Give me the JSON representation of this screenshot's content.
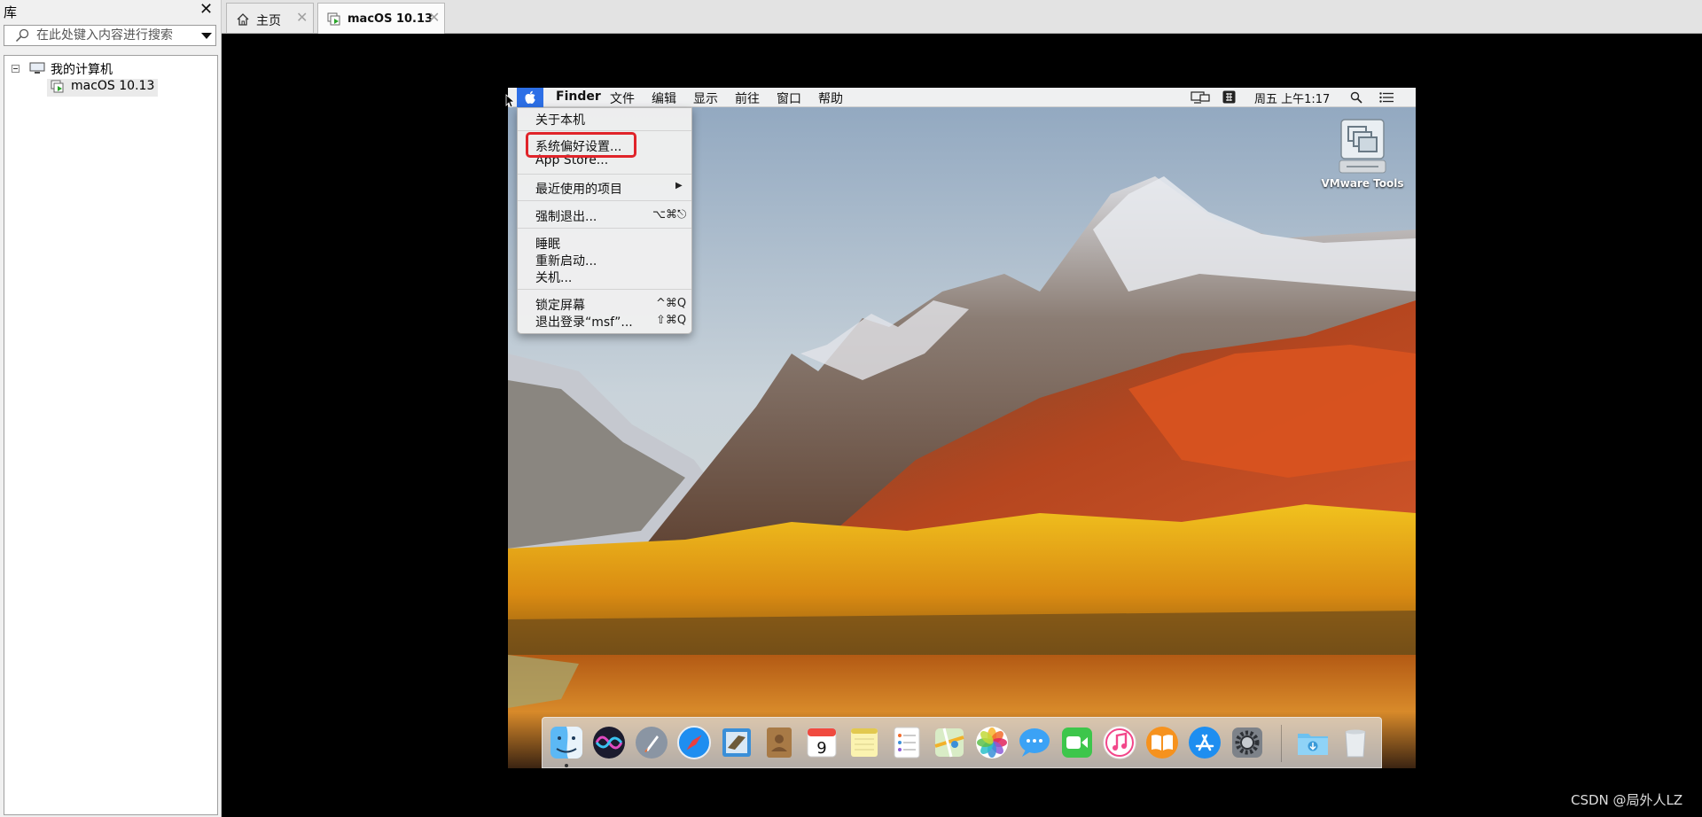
{
  "library": {
    "title": "库",
    "search_placeholder": "在此处键入内容进行搜索",
    "tree": {
      "root_label": "我的计算机",
      "vm_label": "macOS 10.13"
    }
  },
  "tabs": [
    {
      "label": "主页",
      "icon": "home-icon",
      "active": false
    },
    {
      "label": "macOS 10.13",
      "icon": "vm-icon",
      "active": true
    }
  ],
  "mac": {
    "menubar": {
      "app": "Finder",
      "items": [
        "文件",
        "编辑",
        "显示",
        "前往",
        "窗口",
        "帮助"
      ],
      "clock": "周五 上午1:17"
    },
    "apple_menu": {
      "items": [
        {
          "label": "关于本机",
          "shortcut": ""
        },
        {
          "label": "系统偏好设置...",
          "shortcut": ""
        },
        {
          "label": "App Store...",
          "shortcut": ""
        },
        {
          "label": "最近使用的项目",
          "shortcut": "▶"
        },
        {
          "label": "强制退出...",
          "shortcut": "⌥⌘⎋"
        },
        {
          "label": "睡眠",
          "shortcut": ""
        },
        {
          "label": "重新启动...",
          "shortcut": ""
        },
        {
          "label": "关机...",
          "shortcut": ""
        },
        {
          "label": "锁定屏幕",
          "shortcut": "^⌘Q"
        },
        {
          "label": "退出登录“msf”...",
          "shortcut": "⇧⌘Q"
        }
      ]
    },
    "desktop": {
      "vmtools_label": "VMware Tools"
    },
    "dock_apps": [
      "finder",
      "siri",
      "launchpad",
      "safari",
      "mail",
      "contacts",
      "calendar",
      "notes",
      "reminders",
      "maps",
      "photos",
      "messages",
      "facetime",
      "itunes",
      "ibooks",
      "app-store",
      "system-preferences",
      "downloads",
      "trash"
    ],
    "calendar_day": "9"
  },
  "watermark": "CSDN @局外人LZ",
  "colors": {
    "menu_highlight": "#2d6fe6",
    "annotation_red": "#e0242a"
  }
}
